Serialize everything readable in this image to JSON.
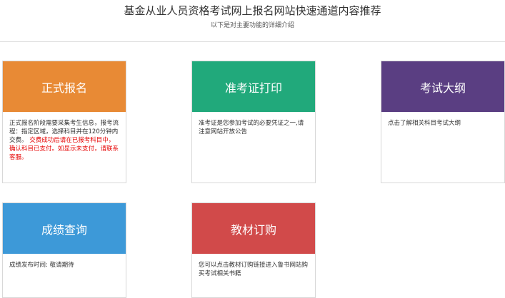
{
  "header": {
    "title": "基金从业人员资格考试网上报名网站快速通道内容推荐",
    "subtitle": "以下是对主要功能的详细介绍"
  },
  "cards": [
    {
      "title": "正式报名",
      "color": "#e88a35",
      "desc": "正式报名阶段需要采集考生信息，报考流程：指定区域，选择科目并在120分钟内交费。",
      "warning": "交费成功后请在已报考科目中，确认科目已支付。如显示未支付，请联系客服。"
    },
    {
      "title": "准考证打印",
      "color": "#21a97b",
      "desc": "准考证是您参加考试的必要凭证之一,请注意网站开放公告"
    },
    {
      "title": "考试大纲",
      "color": "#5a3e82",
      "desc": "点击了解相关科目考试大纲"
    },
    {
      "title": "成绩查询",
      "color": "#3d99d8",
      "desc": "成绩发布时间: 敬请期待"
    },
    {
      "title": "教材订购",
      "color": "#d14a4a",
      "desc": "您可以点击教材订购链接进入鲁书网站购买考试相关书籍"
    }
  ]
}
